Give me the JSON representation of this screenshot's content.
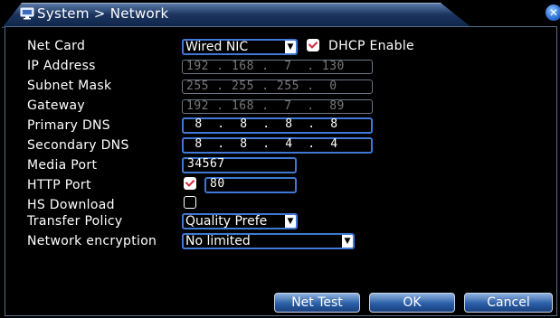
{
  "title": {
    "text": "System > Network"
  },
  "fields": {
    "net_card": {
      "label": "Net Card",
      "value": "Wired NIC"
    },
    "dhcp": {
      "label": "DHCP Enable",
      "checked": true
    },
    "ip_address": {
      "label": "IP Address",
      "value": "192 . 168 .  7  . 130"
    },
    "subnet_mask": {
      "label": "Subnet Mask",
      "value": "255 . 255 . 255 .  0"
    },
    "gateway": {
      "label": "Gateway",
      "value": "192 . 168 .  7  .  89"
    },
    "primary_dns": {
      "label": "Primary DNS",
      "value": " 8  .  8  .  8  .  8"
    },
    "secondary_dns": {
      "label": "Secondary DNS",
      "value": " 8  .  8  .  4  .  4"
    },
    "media_port": {
      "label": "Media Port",
      "value": "34567"
    },
    "http_port": {
      "label": "HTTP Port",
      "checked": true,
      "value": "80"
    },
    "hs_download": {
      "label": "HS Download",
      "checked": false
    },
    "transfer_policy": {
      "label": "Transfer Policy",
      "value": "Quality Prefe"
    },
    "network_encryption": {
      "label": "Network encryption",
      "value": "No limited"
    }
  },
  "buttons": {
    "net_test": "Net Test",
    "ok": "OK",
    "cancel": "Cancel"
  },
  "colors": {
    "accent_border": "#3f78d6",
    "title_bar": "#1c355f",
    "check_mark": "#d6263b"
  }
}
